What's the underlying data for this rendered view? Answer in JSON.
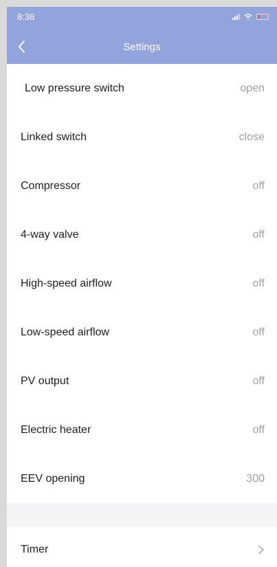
{
  "status_bar": {
    "time": "8:36"
  },
  "nav": {
    "title": "Settings"
  },
  "rows": [
    {
      "label": "Low pressure switch",
      "value": "open"
    },
    {
      "label": "Linked switch",
      "value": "close"
    },
    {
      "label": "Compressor",
      "value": "off"
    },
    {
      "label": "4-way valve",
      "value": "off"
    },
    {
      "label": "High-speed airflow",
      "value": "off"
    },
    {
      "label": "Low-speed airflow",
      "value": "off"
    },
    {
      "label": "PV output",
      "value": "off"
    },
    {
      "label": "Electric heater",
      "value": "off"
    },
    {
      "label": "EEV opening",
      "value": "300"
    }
  ],
  "timer": {
    "label": "Timer",
    "icon": "chevron-right-icon"
  },
  "colors": {
    "header": "#93a4dc",
    "value_text": "#a0a0a0",
    "section_gap": "#f4f4f6"
  }
}
